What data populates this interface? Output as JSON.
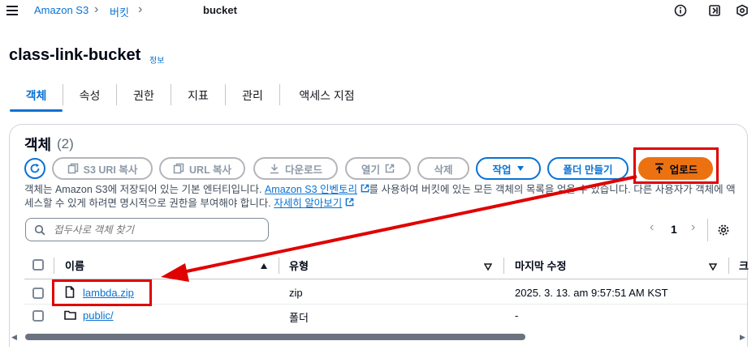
{
  "breadcrumb": {
    "items": [
      {
        "label": "Amazon S3"
      },
      {
        "label": "버킷"
      }
    ],
    "current": "bucket"
  },
  "page": {
    "title": "class-link-bucket",
    "info": "정보"
  },
  "tabs": [
    {
      "label": "객체",
      "active": true
    },
    {
      "label": "속성"
    },
    {
      "label": "권한"
    },
    {
      "label": "지표"
    },
    {
      "label": "관리"
    },
    {
      "label": "액세스 지점"
    }
  ],
  "objects": {
    "title": "객체",
    "count": "(2)",
    "buttons": {
      "copy_s3_uri": "S3 URI 복사",
      "copy_url": "URL 복사",
      "download": "다운로드",
      "open": "열기",
      "delete": "삭제",
      "actions": "작업",
      "create_folder": "폴더 만들기",
      "upload": "업로드"
    },
    "description_1": "객체는 Amazon S3에 저장되어 있는 기본 엔터티입니다. ",
    "description_link1": "Amazon S3 인벤토리",
    "description_2": "를 사용하여 버킷에 있는 모든 객체의 목록을 얻을 수 있습니다. 다른 사용자가 객체에 액세스할 수 있게 하려면 명시적으로 권한을 부여해야 합니다. ",
    "description_link2": "자세히 알아보기",
    "search_placeholder": "접두사로 객체 찾기",
    "page_number": "1",
    "columns": {
      "name": "이름",
      "type": "유형",
      "modified": "마지막 수정",
      "size_partial": "크"
    },
    "rows": [
      {
        "name": "lambda.zip",
        "type": "zip",
        "modified": "2025. 3. 13. am 9:57:51 AM KST"
      },
      {
        "name": "public/",
        "type": "폴더",
        "modified": "-"
      }
    ]
  },
  "annotation_color": "#e00000",
  "accent_color": "#0972d3",
  "upload_color": "#ec7211"
}
